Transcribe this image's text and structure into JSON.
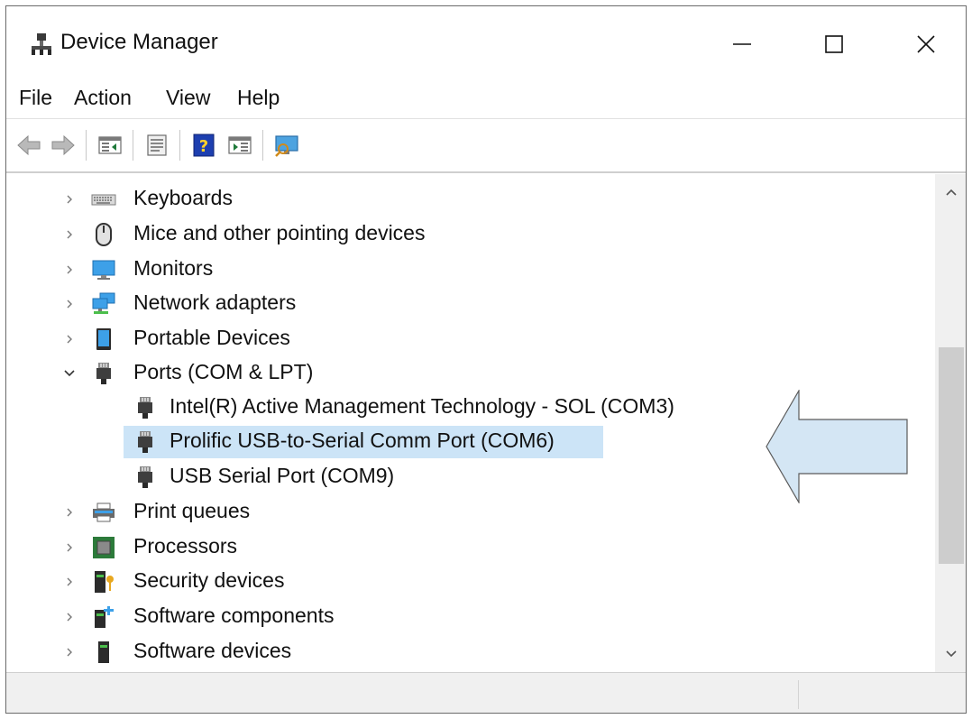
{
  "window": {
    "title": "Device Manager"
  },
  "menu": {
    "file": "File",
    "action": "Action",
    "view": "View",
    "help": "Help"
  },
  "toolbar": {
    "icons": [
      "back-icon",
      "forward-icon",
      "show-hide-console-tree-icon",
      "properties-icon",
      "help-icon",
      "update-driver-icon",
      "scan-hardware-icon"
    ]
  },
  "tree": {
    "items": [
      {
        "label": "Keyboards",
        "expanded": false,
        "icon": "keyboard-icon"
      },
      {
        "label": "Mice and other pointing devices",
        "expanded": false,
        "icon": "mouse-icon"
      },
      {
        "label": "Monitors",
        "expanded": false,
        "icon": "monitor-icon"
      },
      {
        "label": "Network adapters",
        "expanded": false,
        "icon": "network-adapter-icon"
      },
      {
        "label": "Portable Devices",
        "expanded": false,
        "icon": "portable-device-icon"
      },
      {
        "label": "Ports (COM & LPT)",
        "expanded": true,
        "icon": "port-icon",
        "children": [
          {
            "label": "Intel(R) Active Management Technology - SOL (COM3)",
            "icon": "port-icon"
          },
          {
            "label": "Prolific USB-to-Serial Comm Port (COM6)",
            "icon": "port-icon",
            "selected": true
          },
          {
            "label": "USB Serial Port (COM9)",
            "icon": "port-icon"
          }
        ]
      },
      {
        "label": "Print queues",
        "expanded": false,
        "icon": "printer-icon"
      },
      {
        "label": "Processors",
        "expanded": false,
        "icon": "processor-icon"
      },
      {
        "label": "Security devices",
        "expanded": false,
        "icon": "security-device-icon"
      },
      {
        "label": "Software components",
        "expanded": false,
        "icon": "software-component-icon"
      },
      {
        "label": "Software devices",
        "expanded": false,
        "icon": "software-device-icon"
      }
    ]
  },
  "colors": {
    "selection": "#cce4f7",
    "annotation_arrow_fill": "#d4e6f4",
    "annotation_arrow_stroke": "#5a5a5a"
  }
}
